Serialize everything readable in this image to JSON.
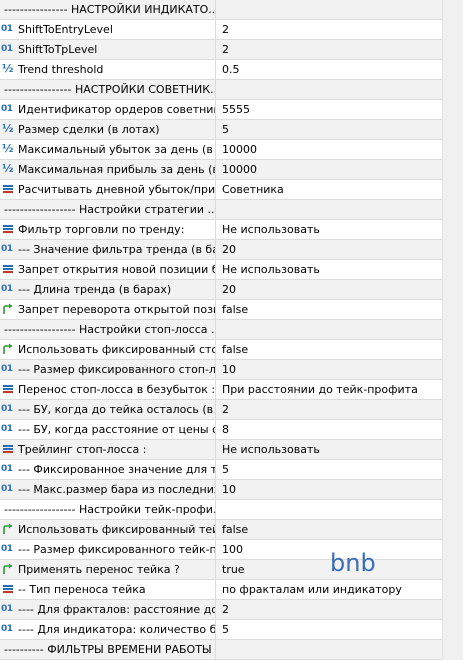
{
  "rows": [
    {
      "type": "sep",
      "name": "---------------- НАСТРОЙКИ ИНДИКАТО...",
      "value": ""
    },
    {
      "type": "int",
      "name": "ShiftToEntryLevel",
      "value": "2"
    },
    {
      "type": "int",
      "name": "ShiftToTpLevel",
      "value": "2"
    },
    {
      "type": "dbl",
      "name": "Trend threshold",
      "value": "0.5"
    },
    {
      "type": "sep",
      "name": "----------------- НАСТРОЙКИ СОВЕТНИК...",
      "value": ""
    },
    {
      "type": "int",
      "name": "Идентификатор ордеров советника...",
      "value": "5555"
    },
    {
      "type": "dbl",
      "name": "Размер сделки (в лотах)",
      "value": "5"
    },
    {
      "type": "dbl",
      "name": "Максимальный убыток за день (в е...",
      "value": "10000"
    },
    {
      "type": "dbl",
      "name": "Максимальная прибыль за день (в е...",
      "value": "10000"
    },
    {
      "type": "enum",
      "name": "Расчитывать дневной убыток/приб...",
      "value": "Советника"
    },
    {
      "type": "sep",
      "name": "------------------ Настройки стратегии  ...",
      "value": ""
    },
    {
      "type": "enum",
      "name": "Фильтр торговли по тренду:",
      "value": "Не использовать"
    },
    {
      "type": "int",
      "name": "--- Значение фильтра тренда (в бара...",
      "value": "20"
    },
    {
      "type": "enum",
      "name": "Запрет открытия новой позиции бе...",
      "value": "Не использовать"
    },
    {
      "type": "int",
      "name": "--- Длина тренда (в барах)",
      "value": "20"
    },
    {
      "type": "bool",
      "name": "Запрет переворота открытой позиц...",
      "value": "false"
    },
    {
      "type": "sep",
      "name": "------------------ Настройки стоп-лосса  ...",
      "value": ""
    },
    {
      "type": "bool",
      "name": "Использовать фиксированный стоп-...",
      "value": "false"
    },
    {
      "type": "int",
      "name": "--- Размер фиксированного стоп-лос...",
      "value": "10"
    },
    {
      "type": "enum",
      "name": "Перенос стоп-лосса в безубыток :",
      "value": "При расстоянии до тейк-профита"
    },
    {
      "type": "int",
      "name": "--- БУ, когда до тейка осталось (в т...",
      "value": "2"
    },
    {
      "type": "int",
      "name": "--- БУ, когда расстояние от цены от...",
      "value": "8"
    },
    {
      "type": "enum",
      "name": "Трейлинг стоп-лосса :",
      "value": "Не использовать"
    },
    {
      "type": "int",
      "name": "--- Фиксированное значение для тр...",
      "value": "5"
    },
    {
      "type": "int",
      "name": "--- Макс.размер бара из последних (...",
      "value": "10"
    },
    {
      "type": "sep",
      "name": "------------------ Настройки тейк-профи...",
      "value": ""
    },
    {
      "type": "bool",
      "name": "Использовать фиксированный тейк...",
      "value": "false"
    },
    {
      "type": "int",
      "name": "--- Размер фиксированного тейк-пр...",
      "value": "100"
    },
    {
      "type": "bool",
      "name": "Применять перенос тейка ?",
      "value": "true"
    },
    {
      "type": "enum",
      "name": "-- Тип переноса тейка",
      "value": "по фракталам или индикатору"
    },
    {
      "type": "int",
      "name": "---- Для фракталов: расстояние до ...",
      "value": "2"
    },
    {
      "type": "int",
      "name": "---- Для индикатора: количество ба...",
      "value": "5"
    },
    {
      "type": "sep",
      "name": "---------- ФИЛЬТРЫ ВРЕМЕНИ РАБОТЫ СОВ...",
      "value": ""
    }
  ],
  "icons": {
    "int": {
      "name": "int-type-icon",
      "glyph": "01"
    },
    "dbl": {
      "name": "double-type-icon",
      "glyph": "½"
    },
    "enum": {
      "name": "enum-list-icon"
    },
    "bool": {
      "name": "bool-arrow-icon"
    }
  },
  "watermark": "bnb"
}
